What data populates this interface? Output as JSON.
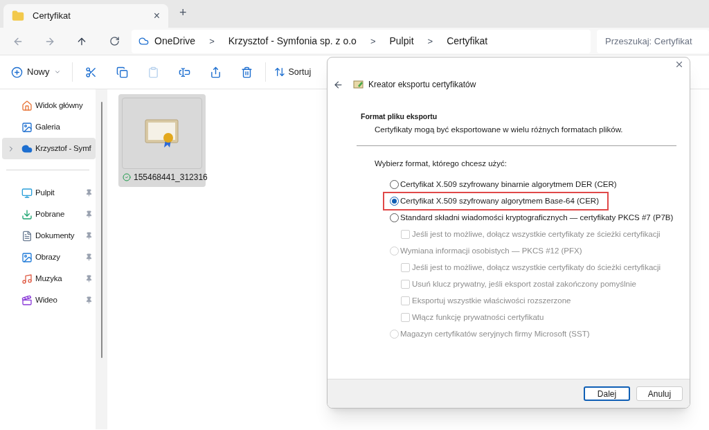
{
  "tab": {
    "title": "Certyfikat",
    "close": "×",
    "new_tab": "+"
  },
  "address_bar": {
    "breadcrumbs": [
      "OneDrive",
      "Krzysztof - Symfonia sp. z o.o",
      "Pulpit",
      "Certyfikat"
    ],
    "separator": ">"
  },
  "search": {
    "placeholder": "Przeszukaj: Certyfikat"
  },
  "toolbar": {
    "new_label": "Nowy",
    "sort_label": "Sortuj",
    "actions": [
      {
        "kind": "cut",
        "disabled": false
      },
      {
        "kind": "copy",
        "disabled": false
      },
      {
        "kind": "paste",
        "disabled": true
      },
      {
        "kind": "rename",
        "disabled": false
      },
      {
        "kind": "share",
        "disabled": false
      },
      {
        "kind": "delete",
        "disabled": false
      }
    ]
  },
  "sidebar": {
    "groups": [
      [
        {
          "label": "Widok główny",
          "selected": false,
          "expandable": false,
          "pinned": false
        },
        {
          "label": "Galeria",
          "selected": false,
          "expandable": false,
          "pinned": false
        },
        {
          "label": "Krzysztof - Symf",
          "selected": true,
          "expandable": true,
          "pinned": false
        }
      ],
      [
        {
          "label": "Pulpit",
          "selected": false,
          "expandable": false,
          "pinned": true
        },
        {
          "label": "Pobrane",
          "selected": false,
          "expandable": false,
          "pinned": true
        },
        {
          "label": "Dokumenty",
          "selected": false,
          "expandable": false,
          "pinned": true
        },
        {
          "label": "Obrazy",
          "selected": false,
          "expandable": false,
          "pinned": true
        },
        {
          "label": "Muzyka",
          "selected": false,
          "expandable": false,
          "pinned": true
        },
        {
          "label": "Wideo",
          "selected": false,
          "expandable": false,
          "pinned": true
        }
      ]
    ]
  },
  "files": [
    {
      "name": "155468441_312316",
      "selected": true,
      "synced": true
    }
  ],
  "dialog": {
    "title": "Kreator eksportu certyfikatów",
    "heading": "Format pliku eksportu",
    "subtitle": "Certyfikaty mogą być eksportowane w wielu różnych formatach plików.",
    "prompt": "Wybierz format, którego chcesz użyć:",
    "options": [
      {
        "kind": "radio",
        "label": "Certyfikat X.509 szyfrowany binarnie algorytmem DER (CER)",
        "selected": false,
        "disabled": false,
        "highlighted": false
      },
      {
        "kind": "radio",
        "label": "Certyfikat X.509 szyfrowany algorytmem Base-64 (CER)",
        "selected": true,
        "disabled": false,
        "highlighted": true
      },
      {
        "kind": "radio",
        "label": "Standard składni wiadomości kryptograficznych — certyfikaty PKCS #7 (P7B)",
        "selected": false,
        "disabled": false,
        "highlighted": false
      },
      {
        "kind": "checkbox",
        "label": "Jeśli jest to możliwe, dołącz wszystkie certyfikaty ze ścieżki certyfikacji",
        "checked": false,
        "disabled": true
      },
      {
        "kind": "radio",
        "label": "Wymiana informacji osobistych — PKCS #12 (PFX)",
        "selected": false,
        "disabled": true,
        "highlighted": false
      },
      {
        "kind": "checkbox",
        "label": "Jeśli jest to możliwe, dołącz wszystkie certyfikaty do ścieżki certyfikacji",
        "checked": false,
        "disabled": true
      },
      {
        "kind": "checkbox",
        "label": "Usuń klucz prywatny, jeśli eksport został zakończony pomyślnie",
        "checked": false,
        "disabled": true
      },
      {
        "kind": "checkbox",
        "label": "Eksportuj wszystkie właściwości rozszerzone",
        "checked": false,
        "disabled": true
      },
      {
        "kind": "checkbox",
        "label": "Włącz funkcję prywatności certyfikatu",
        "checked": false,
        "disabled": true
      },
      {
        "kind": "radio",
        "label": "Magazyn certyfikatów seryjnych firmy Microsoft (SST)",
        "selected": false,
        "disabled": true,
        "highlighted": false
      }
    ],
    "buttons": [
      {
        "label": "Dalej",
        "default": true
      },
      {
        "label": "Anuluj",
        "default": false
      }
    ]
  }
}
